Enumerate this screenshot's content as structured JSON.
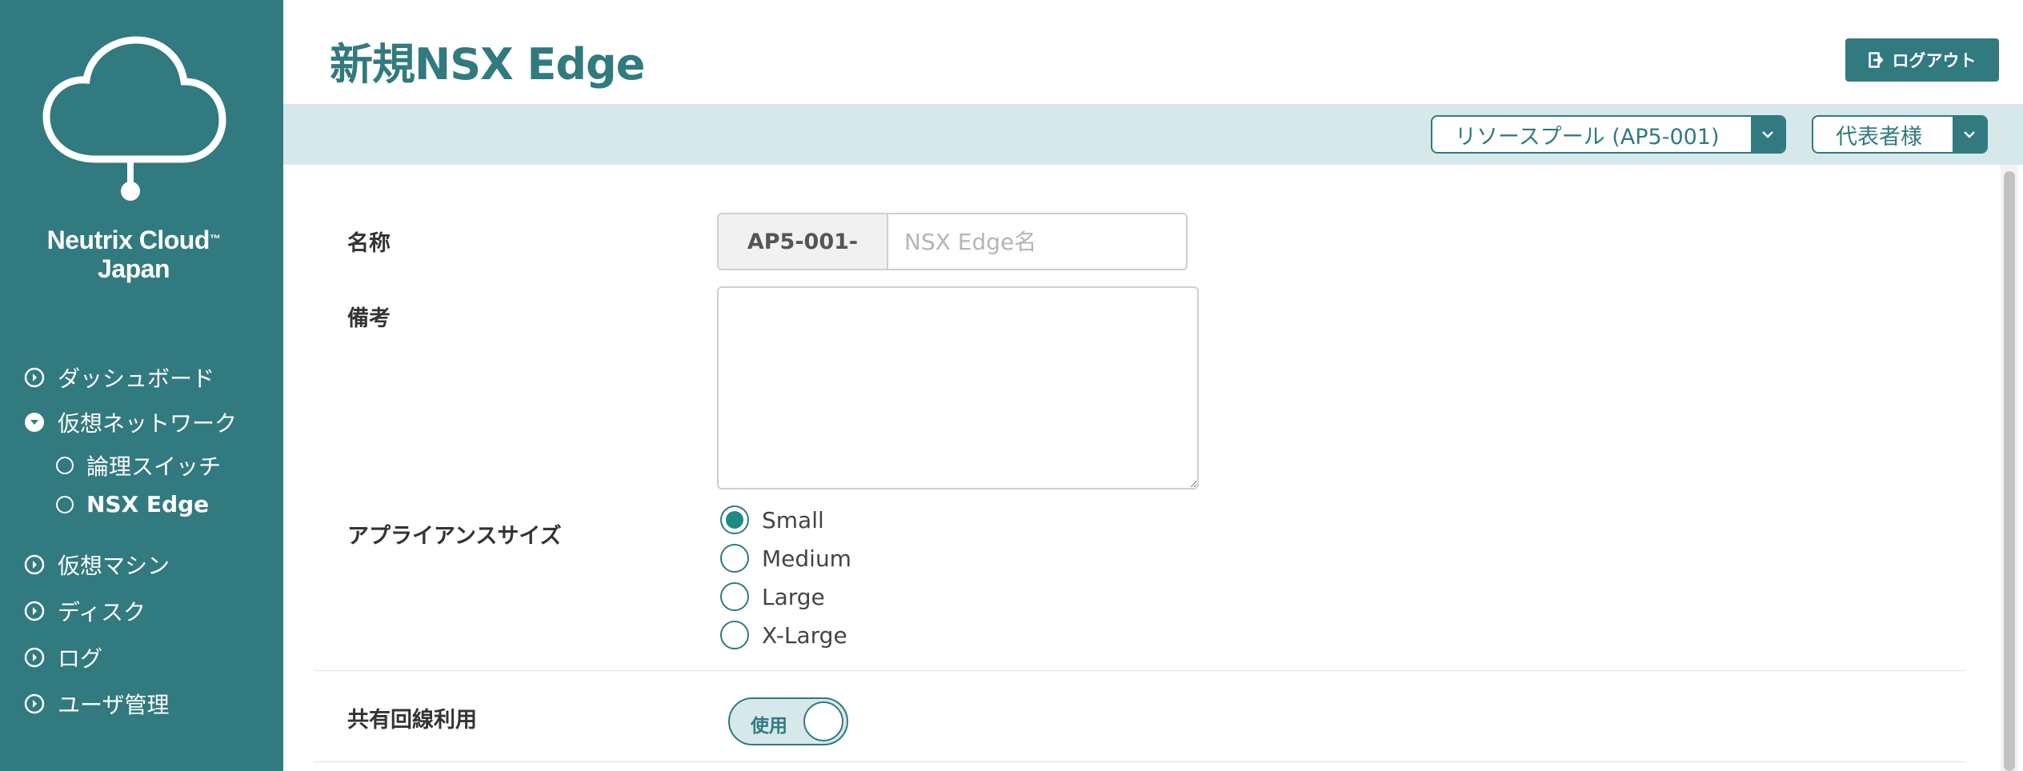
{
  "brand": {
    "line1": "Neutrix Cloud",
    "tm": "™",
    "line2": "Japan"
  },
  "nav": {
    "items": [
      {
        "label": "ダッシュボード"
      },
      {
        "label": "仮想ネットワーク"
      },
      {
        "label": "仮想マシン"
      },
      {
        "label": "ディスク"
      },
      {
        "label": "ログ"
      },
      {
        "label": "ユーザ管理"
      }
    ],
    "sub_items": [
      {
        "label": "論理スイッチ"
      },
      {
        "label": "NSX Edge"
      }
    ]
  },
  "header": {
    "title": "新規NSX Edge",
    "logout_label": "ログアウト",
    "resource_pool": "リソースプール (AP5-001)",
    "user": "代表者様"
  },
  "form": {
    "name_label": "名称",
    "name_prefix": "AP5-001-",
    "name_placeholder": "NSX Edge名",
    "name_value": "",
    "memo_label": "備考",
    "memo_value": "",
    "size_label": "アプライアンスサイズ",
    "size_options": [
      "Small",
      "Medium",
      "Large",
      "X-Large"
    ],
    "size_selected": "Small",
    "shared_label": "共有回線利用",
    "shared_toggle_label": "使用"
  },
  "colors": {
    "accent": "#317a7f",
    "band": "#d6e8ea",
    "radio_dot": "#1d8a86"
  }
}
